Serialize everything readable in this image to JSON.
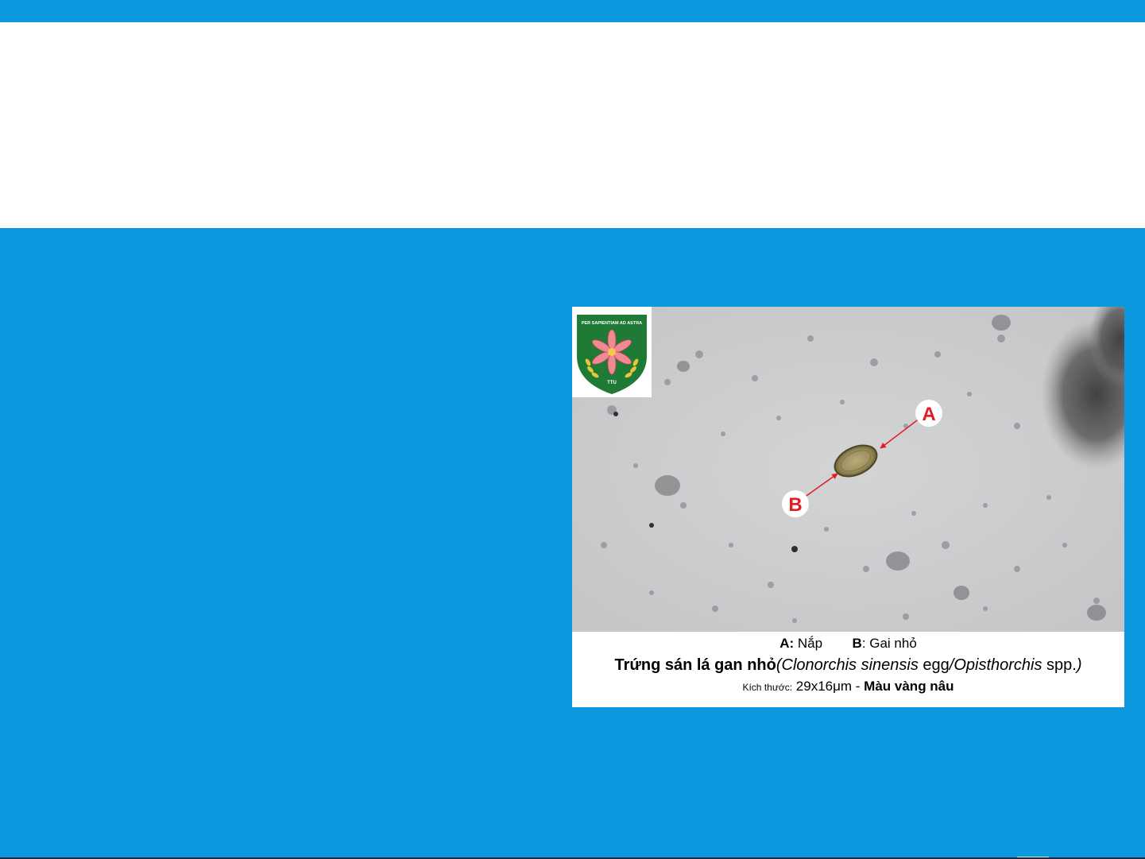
{
  "slide": {
    "colors": {
      "accent": "#0b98df",
      "background": "#ffffff",
      "label_red": "#e31b23",
      "shield_green": "#1f7a36"
    }
  },
  "logo": {
    "motto": "PER SAPIENTIAM AD ASTRA",
    "initials": "TTU"
  },
  "figure": {
    "marker_a": "A",
    "marker_b": "B",
    "legend": {
      "a_key": "A:",
      "a_text": "Nắp",
      "b_key": "B",
      "b_text": ": Gai nhỏ"
    },
    "title": {
      "bold": "Trứng sán lá gan nhỏ",
      "paren_open": "(",
      "species1": "Clonorchis sinensis",
      "egg": " egg",
      "slash_species2": "/Opisthorchis",
      "spp": " spp.",
      "paren_close": ")"
    },
    "size_line": {
      "label": "Kích thước:",
      "value": " 29x16μm - ",
      "color": "Màu vàng nâu"
    }
  }
}
